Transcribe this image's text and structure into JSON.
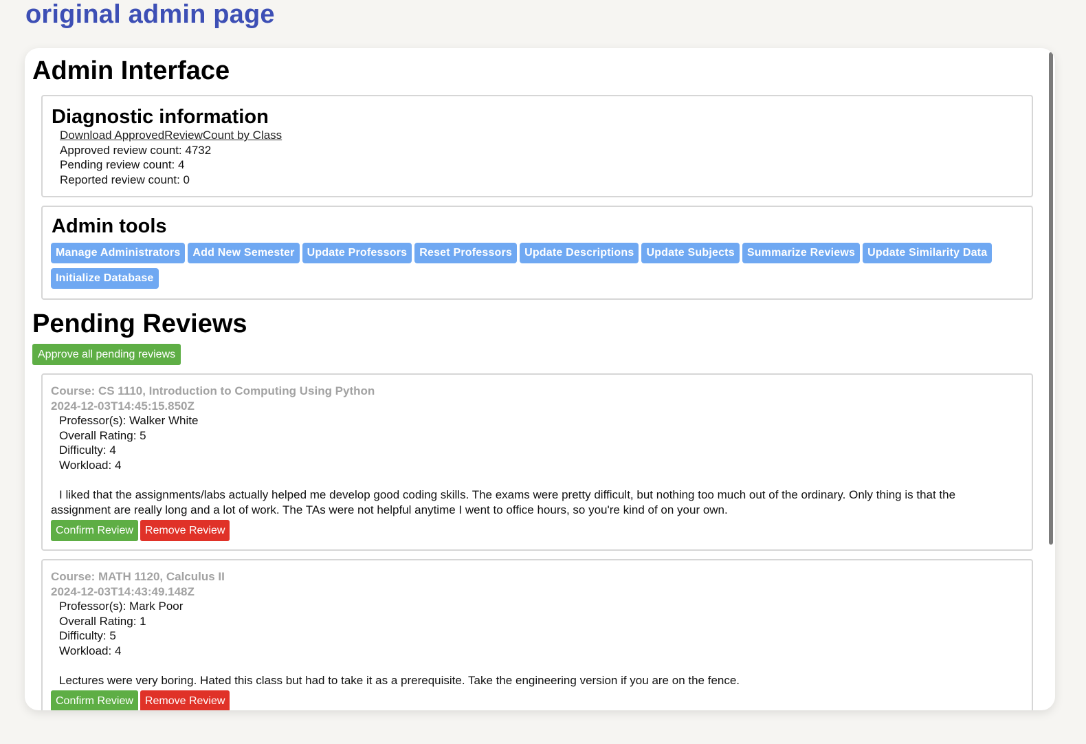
{
  "caption": "original admin page",
  "title": "Admin Interface",
  "diagnostics": {
    "heading": "Diagnostic information",
    "download_link": "Download ApprovedReviewCount by Class",
    "approved": "Approved review count: 4732",
    "pending": "Pending review count: 4",
    "reported": "Reported review count: 0"
  },
  "tools": {
    "heading": "Admin tools",
    "buttons": [
      "Manage Administrators",
      "Add New Semester",
      "Update Professors",
      "Reset Professors",
      "Update Descriptions",
      "Update Subjects",
      "Summarize Reviews",
      "Update Similarity Data",
      "Initialize Database"
    ],
    "button_color": "#6fa8f2"
  },
  "pending": {
    "heading": "Pending Reviews",
    "approve_all_label": "Approve all pending reviews",
    "confirm_label": "Confirm Review",
    "remove_label": "Remove Review",
    "reviews": [
      {
        "course": "Course: CS 1110, Introduction to Computing Using Python",
        "date": "2024-12-03T14:45:15.850Z",
        "professors": "Professor(s): Walker White",
        "overall": "Overall Rating: 5",
        "difficulty": "Difficulty: 4",
        "workload": "Workload: 4",
        "text": "I liked that the assignments/labs actually helped me develop good coding skills. The exams were pretty difficult, but nothing too much out of the ordinary. Only thing is that the assignment are really long and a lot of work. The TAs were not helpful anytime I went to office hours, so you're kind of on your own."
      },
      {
        "course": "Course: MATH 1120, Calculus II",
        "date": "2024-12-03T14:43:49.148Z",
        "professors": "Professor(s): Mark Poor",
        "overall": "Overall Rating: 1",
        "difficulty": "Difficulty: 5",
        "workload": "Workload: 4",
        "text": "Lectures were very boring. Hated this class but had to take it as a prerequisite. Take the engineering version if you are on the fence."
      }
    ]
  },
  "colors": {
    "accent_blue": "#3d4fb5",
    "confirm_green": "#5eae45",
    "remove_red": "#e03228"
  }
}
